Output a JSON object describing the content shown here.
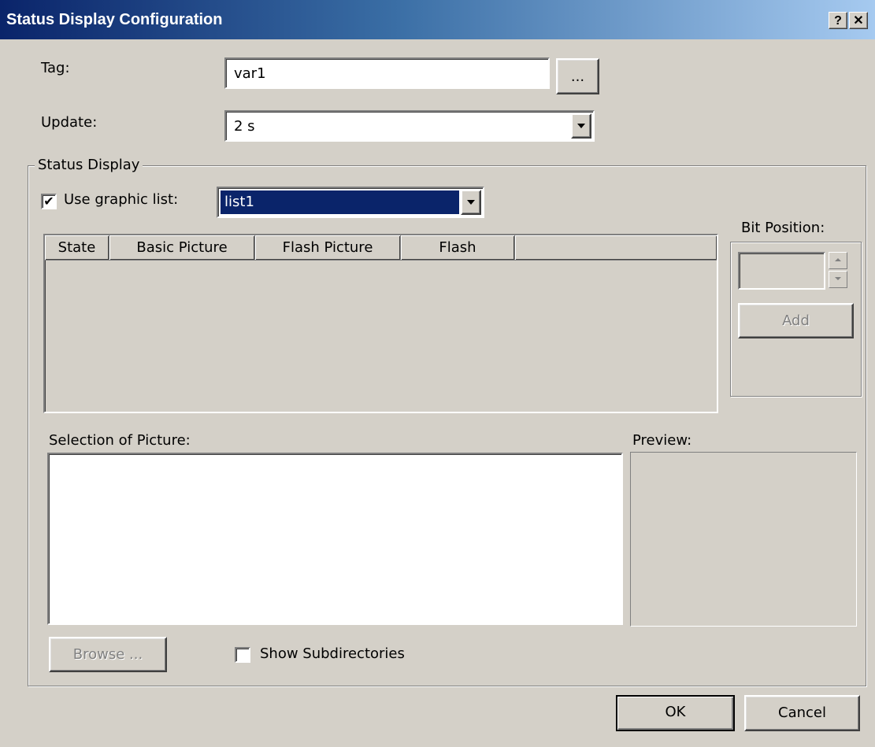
{
  "window": {
    "title": "Status Display Configuration",
    "help_label": "?",
    "close_label": "✕"
  },
  "tag": {
    "label": "Tag:",
    "value": "var1",
    "browse_label": "..."
  },
  "update": {
    "label": "Update:",
    "value": "2 s"
  },
  "status_display": {
    "group_label": "Status Display",
    "use_graphic_list_label": "Use graphic list:",
    "use_graphic_list_checked": true,
    "checkmark": "✔",
    "graphic_list_value": "list1",
    "table_columns": [
      "State",
      "Basic Picture",
      "Flash Picture",
      "Flash"
    ],
    "bit_position_label": "Bit Position:",
    "bit_position_value": "",
    "add_label": "Add",
    "selection_label": "Selection of Picture:",
    "preview_label": "Preview:",
    "browse_label": "Browse ...",
    "show_subdirs_label": "Show Subdirectories",
    "show_subdirs_checked": false
  },
  "footer": {
    "ok_label": "OK",
    "cancel_label": "Cancel"
  },
  "colors": {
    "title_bar_start": "#0a246a",
    "title_bar_end": "#a6caf0",
    "dialog_bg": "#d4d0c8",
    "selection_bg": "#0a246a"
  }
}
